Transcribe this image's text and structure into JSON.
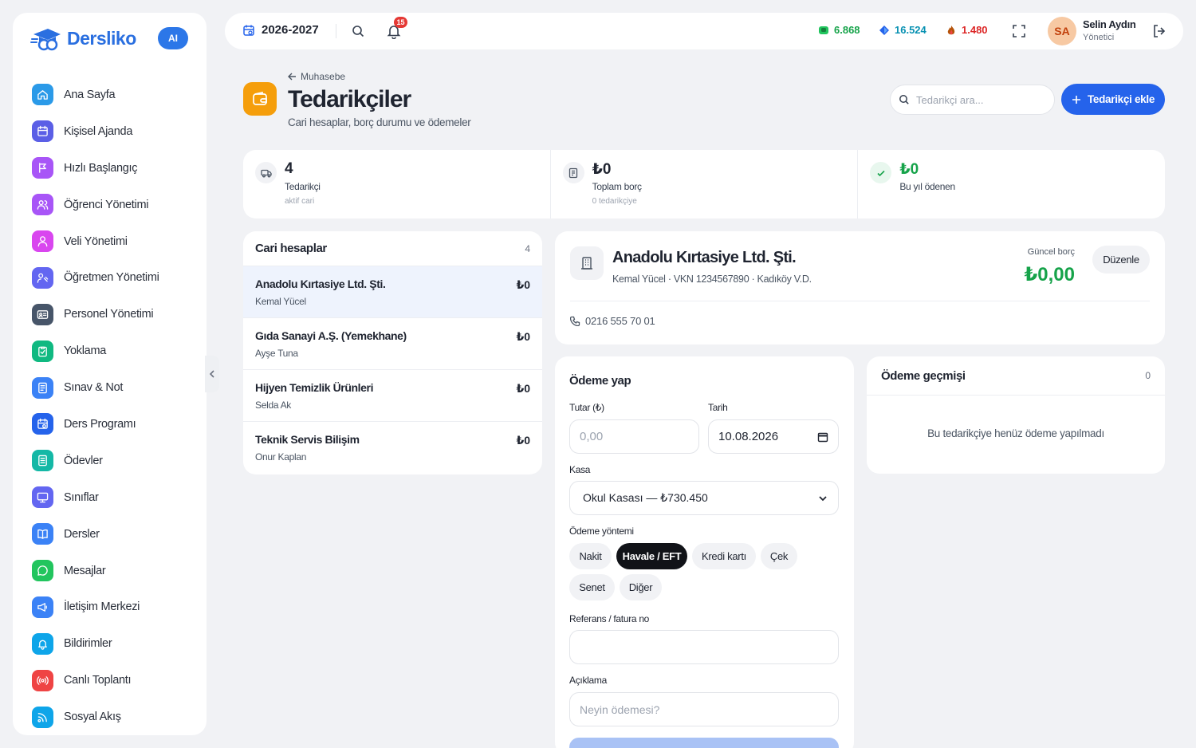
{
  "brand": {
    "name": "Dersliko",
    "ai_label": "AI"
  },
  "sidebar": {
    "items": [
      {
        "label": "Ana Sayfa",
        "icon": "home-icon",
        "color": "#2b9ae8"
      },
      {
        "label": "Kişisel Ajanda",
        "icon": "calendar-icon",
        "color": "#5b5fe6"
      },
      {
        "label": "Hızlı Başlangıç",
        "icon": "play-icon",
        "color": "#a855f7"
      },
      {
        "label": "Öğrenci Yönetimi",
        "icon": "users-icon",
        "color": "#a855f7"
      },
      {
        "label": "Veli Yönetimi",
        "icon": "parents-icon",
        "color": "#d946ef"
      },
      {
        "label": "Öğretmen Yönetimi",
        "icon": "teacher-icon",
        "color": "#6366f1"
      },
      {
        "label": "Personel Yönetimi",
        "icon": "id-card-icon",
        "color": "#475569"
      },
      {
        "label": "Yoklama",
        "icon": "clipboard-check-icon",
        "color": "#10b981"
      },
      {
        "label": "Sınav & Not",
        "icon": "exam-icon",
        "color": "#3b82f6"
      },
      {
        "label": "Ders Programı",
        "icon": "schedule-icon",
        "color": "#2563eb"
      },
      {
        "label": "Ödevler",
        "icon": "homework-icon",
        "color": "#14b8a6"
      },
      {
        "label": "Sınıflar",
        "icon": "classroom-icon",
        "color": "#6366f1"
      },
      {
        "label": "Dersler",
        "icon": "book-icon",
        "color": "#3b82f6"
      },
      {
        "label": "Mesajlar",
        "icon": "chat-icon",
        "color": "#22c55e"
      },
      {
        "label": "İletişim Merkezi",
        "icon": "megaphone-icon",
        "color": "#3b82f6"
      },
      {
        "label": "Bildirimler",
        "icon": "bell-icon",
        "color": "#0ea5e9"
      },
      {
        "label": "Canlı Toplantı",
        "icon": "broadcast-icon",
        "color": "#ef4444"
      },
      {
        "label": "Sosyal Akış",
        "icon": "rss-icon",
        "color": "#0ea5e9"
      }
    ]
  },
  "topbar": {
    "year": "2026-2027",
    "notification_count": "15",
    "stats": [
      {
        "value": "6.868",
        "color": "#16a34a",
        "icon": "green-gem-icon"
      },
      {
        "value": "16.524",
        "color": "#0891b2",
        "icon": "blue-gem-icon"
      },
      {
        "value": "1.480",
        "color": "#dc2626",
        "icon": "fire-icon"
      }
    ],
    "user": {
      "initials": "SA",
      "name": "Selin Aydın",
      "role": "Yönetici"
    }
  },
  "header": {
    "breadcrumb": "Muhasebe",
    "title": "Tedarikçiler",
    "subtitle": "Cari hesaplar, borç durumu ve ödemeler",
    "search_placeholder": "Tedarikçi ara...",
    "add_label": "Tedarikçi ekle"
  },
  "stats": [
    {
      "value": "4",
      "label": "Tedarikçi",
      "sub": "aktif cari"
    },
    {
      "value": "₺0",
      "label": "Toplam borç",
      "sub": "0 tedarikçiye"
    },
    {
      "value": "₺0",
      "label": "Bu yıl ödenen",
      "sub": ""
    }
  ],
  "accounts": {
    "title": "Cari hesaplar",
    "count": "4",
    "rows": [
      {
        "name": "Anadolu Kırtasiye Ltd. Şti.",
        "contact": "Kemal Yücel",
        "balance": "₺0"
      },
      {
        "name": "Gıda Sanayi A.Ş. (Yemekhane)",
        "contact": "Ayşe Tuna",
        "balance": "₺0"
      },
      {
        "name": "Hijyen Temizlik Ürünleri",
        "contact": "Selda Ak",
        "balance": "₺0"
      },
      {
        "name": "Teknik Servis Bilişim",
        "contact": "Onur Kaplan",
        "balance": "₺0"
      }
    ]
  },
  "detail": {
    "name": "Anadolu Kırtasiye Ltd. Şti.",
    "meta": "Kemal Yücel · VKN 1234567890 · Kadıköy V.D.",
    "debt_label": "Güncel borç",
    "debt_value": "₺0,00",
    "edit_label": "Düzenle",
    "phone": "0216 555 70 01"
  },
  "payment": {
    "title": "Ödeme yap",
    "amount_label": "Tutar (₺)",
    "amount_placeholder": "0,00",
    "date_label": "Tarih",
    "date_value": "10.08.2026",
    "cashbox_label": "Kasa",
    "cashbox_value": "Okul Kasası — ₺730.450",
    "method_label": "Ödeme yöntemi",
    "methods": [
      "Nakit",
      "Havale / EFT",
      "Kredi kartı",
      "Çek",
      "Senet",
      "Diğer"
    ],
    "reference_label": "Referans / fatura no",
    "note_label": "Açıklama",
    "note_placeholder": "Neyin ödemesi?"
  },
  "history": {
    "title": "Ödeme geçmişi",
    "count": "0",
    "empty": "Bu tedarikçiye henüz ödeme yapılmadı"
  }
}
